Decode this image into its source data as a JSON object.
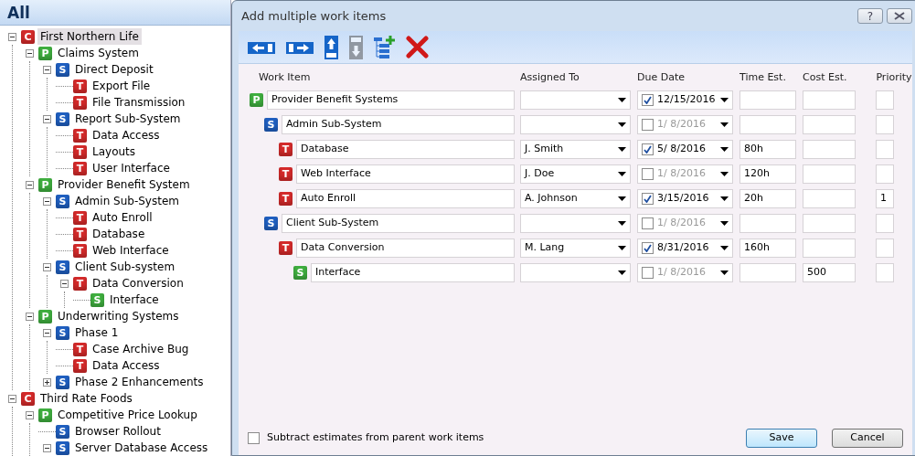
{
  "tree": {
    "title": "All",
    "nodes": [
      {
        "badge": "C",
        "color": "#d42a2a",
        "label": "First Northern Life",
        "selected": true,
        "expanded": true,
        "children": [
          {
            "badge": "P",
            "color": "#3fae3f",
            "label": "Claims System",
            "selected": false,
            "expanded": true,
            "children": [
              {
                "badge": "S",
                "color": "#1f5fc0",
                "label": "Direct Deposit",
                "selected": false,
                "expanded": true,
                "children": [
                  {
                    "badge": "T",
                    "color": "#d42a2a",
                    "label": "Export File",
                    "selected": false
                  },
                  {
                    "badge": "T",
                    "color": "#d42a2a",
                    "label": "File Transmission",
                    "selected": false
                  }
                ]
              },
              {
                "badge": "S",
                "color": "#1f5fc0",
                "label": "Report Sub-System",
                "selected": false,
                "expanded": true,
                "children": [
                  {
                    "badge": "T",
                    "color": "#d42a2a",
                    "label": "Data Access",
                    "selected": false
                  },
                  {
                    "badge": "T",
                    "color": "#d42a2a",
                    "label": "Layouts",
                    "selected": false
                  },
                  {
                    "badge": "T",
                    "color": "#d42a2a",
                    "label": "User Interface",
                    "selected": false
                  }
                ]
              }
            ]
          },
          {
            "badge": "P",
            "color": "#3fae3f",
            "label": "Provider Benefit System",
            "selected": false,
            "expanded": true,
            "children": [
              {
                "badge": "S",
                "color": "#1f5fc0",
                "label": "Admin Sub-System",
                "selected": false,
                "expanded": true,
                "children": [
                  {
                    "badge": "T",
                    "color": "#d42a2a",
                    "label": "Auto Enroll",
                    "selected": false
                  },
                  {
                    "badge": "T",
                    "color": "#d42a2a",
                    "label": "Database",
                    "selected": false
                  },
                  {
                    "badge": "T",
                    "color": "#d42a2a",
                    "label": "Web Interface",
                    "selected": false
                  }
                ]
              },
              {
                "badge": "S",
                "color": "#1f5fc0",
                "label": "Client Sub-system",
                "selected": false,
                "expanded": true,
                "children": [
                  {
                    "badge": "T",
                    "color": "#d42a2a",
                    "label": "Data Conversion",
                    "selected": false,
                    "expanded": true,
                    "children": [
                      {
                        "badge": "S",
                        "color": "#3fae3f",
                        "label": "Interface",
                        "selected": false
                      }
                    ]
                  }
                ]
              }
            ]
          },
          {
            "badge": "P",
            "color": "#3fae3f",
            "label": "Underwriting Systems",
            "selected": false,
            "expanded": true,
            "children": [
              {
                "badge": "S",
                "color": "#1f5fc0",
                "label": "Phase 1",
                "selected": false,
                "expanded": true,
                "children": [
                  {
                    "badge": "T",
                    "color": "#d42a2a",
                    "label": "Case Archive Bug",
                    "selected": false
                  },
                  {
                    "badge": "T",
                    "color": "#d42a2a",
                    "label": "Data Access",
                    "selected": false
                  }
                ]
              },
              {
                "badge": "S",
                "color": "#1f5fc0",
                "label": "Phase 2 Enhancements",
                "selected": false,
                "expanded": false
              }
            ]
          }
        ]
      },
      {
        "badge": "C",
        "color": "#d42a2a",
        "label": "Third Rate Foods",
        "selected": false,
        "expanded": true,
        "children": [
          {
            "badge": "P",
            "color": "#3fae3f",
            "label": "Competitive Price Lookup",
            "selected": false,
            "expanded": true,
            "children": [
              {
                "badge": "S",
                "color": "#1f5fc0",
                "label": "Browser Rollout",
                "selected": false
              },
              {
                "badge": "S",
                "color": "#1f5fc0",
                "label": "Server Database Access",
                "selected": false,
                "expanded": true
              }
            ]
          }
        ]
      }
    ]
  },
  "dialog": {
    "title": "Add multiple work items",
    "help": "?",
    "toolbar": [
      {
        "kind": "outdent",
        "disabled": false
      },
      {
        "kind": "indent",
        "disabled": false
      },
      {
        "kind": "up",
        "disabled": false
      },
      {
        "kind": "down",
        "disabled": true
      },
      {
        "kind": "add",
        "disabled": false
      },
      {
        "kind": "delete",
        "disabled": false
      }
    ],
    "columns": [
      "Work Item",
      "Assigned To",
      "Due Date",
      "Time Est.",
      "Cost Est.",
      "Priority"
    ],
    "rows": [
      {
        "badge": "P",
        "color": "#3fae3f",
        "name": "Provider Benefit Systems",
        "due_checked": true,
        "due": "12/15/2016",
        "children": [
          {
            "badge": "S",
            "color": "#1f5fc0",
            "name": "Admin Sub-System",
            "due_checked": false,
            "due": "1/ 8/2016",
            "children": [
              {
                "badge": "T",
                "color": "#d42a2a",
                "name": "Database",
                "assigned": "J. Smith",
                "due_checked": true,
                "due": "5/ 8/2016",
                "time": "80h"
              },
              {
                "badge": "T",
                "color": "#d42a2a",
                "name": "Web Interface",
                "assigned": "J. Doe",
                "due_checked": false,
                "due": "1/ 8/2016",
                "time": "120h"
              },
              {
                "badge": "T",
                "color": "#d42a2a",
                "name": "Auto Enroll",
                "assigned": "A. Johnson",
                "due_checked": true,
                "due": "3/15/2016",
                "time": "20h",
                "priority": "1"
              }
            ]
          },
          {
            "badge": "S",
            "color": "#1f5fc0",
            "name": "Client Sub-System",
            "due_checked": false,
            "due": "1/ 8/2016",
            "children": [
              {
                "badge": "T",
                "color": "#d42a2a",
                "name": "Data Conversion",
                "assigned": "M. Lang",
                "due_checked": true,
                "due": "8/31/2016",
                "time": "160h",
                "children": [
                  {
                    "badge": "S",
                    "color": "#3fae3f",
                    "name": "Interface",
                    "due_checked": false,
                    "due": "1/ 8/2016",
                    "cost": "500"
                  }
                ]
              }
            ]
          }
        ]
      }
    ],
    "subtract": {
      "label": "Subtract estimates from parent work items",
      "checked": false
    },
    "buttons": [
      {
        "label": "Save",
        "default": true
      },
      {
        "label": "Cancel",
        "default": false
      }
    ]
  }
}
